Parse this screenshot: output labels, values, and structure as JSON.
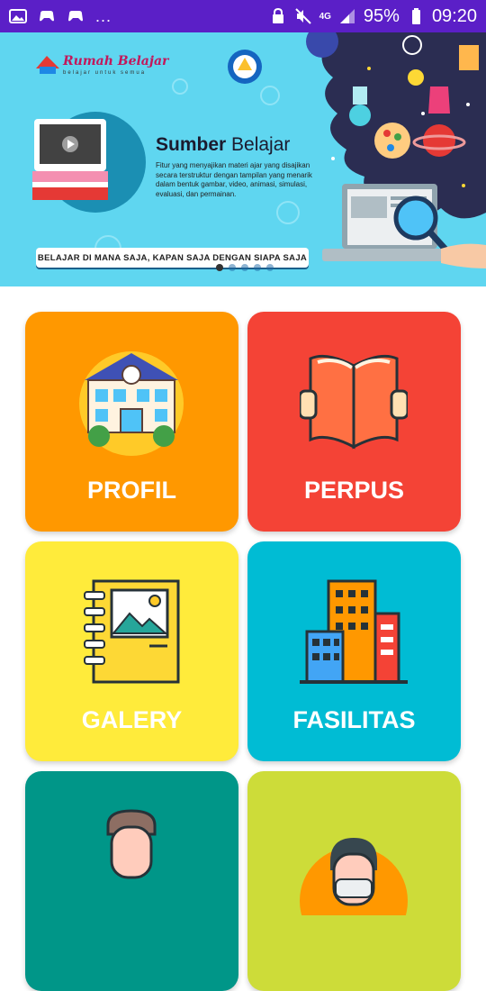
{
  "status_bar": {
    "left_icons": [
      "image-icon",
      "gamepad-icon",
      "gamepad-icon"
    ],
    "overflow": "...",
    "network": "4G",
    "battery_percent": "95%",
    "time": "09:20",
    "background_color": "#5b1fc7"
  },
  "banner": {
    "logo_text": "Rumah Belajar",
    "logo_subtext": "belajar untuk semua",
    "title_bold": "Sumber",
    "title_rest": " Belajar",
    "description": "Fitur yang menyajikan materi ajar yang disajikan secara terstruktur dengan tampilan yang menarik dalam bentuk gambar, video, animasi, simulasi, evaluasi, dan permainan.",
    "tagline": "BELAJAR DI MANA SAJA, KAPAN SAJA DENGAN SIAPA SAJA",
    "slide_count": 5,
    "active_slide": 1,
    "background_color": "#5fd6f0"
  },
  "menu": [
    {
      "label": "PROFIL",
      "color": "#ff9800",
      "icon": "school-building-icon"
    },
    {
      "label": "PERPUS",
      "color": "#f44336",
      "icon": "open-book-icon"
    },
    {
      "label": "GALERY",
      "color": "#ffeb3b",
      "icon": "photo-album-icon"
    },
    {
      "label": "FASILITAS",
      "color": "#00bcd4",
      "icon": "city-buildings-icon"
    },
    {
      "label": "",
      "color": "#009688",
      "icon": "teacher-avatar-icon"
    },
    {
      "label": "",
      "color": "#cddc39",
      "icon": "student-avatar-icon"
    }
  ]
}
